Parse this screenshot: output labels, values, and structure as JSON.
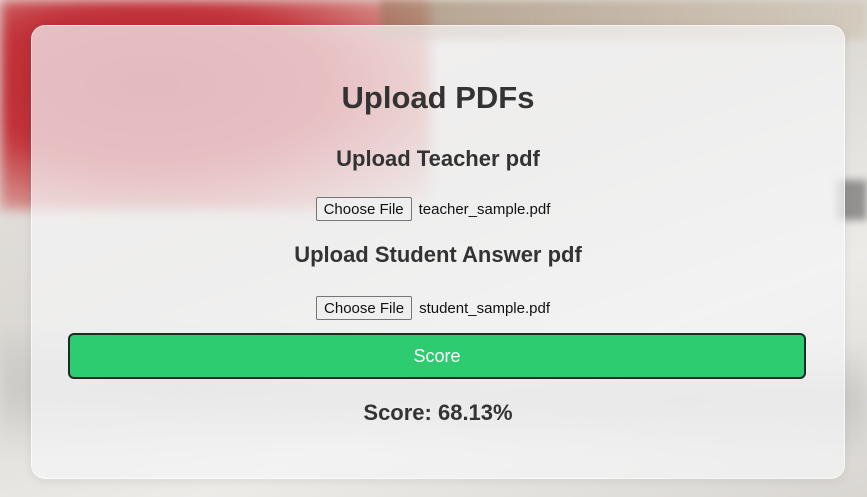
{
  "page": {
    "title": "Upload PDFs",
    "teacher_heading": "Upload Teacher pdf",
    "student_heading": "Upload Student Answer pdf"
  },
  "teacher_file": {
    "button_label": "Choose File",
    "file_name": "teacher_sample.pdf"
  },
  "student_file": {
    "button_label": "Choose File",
    "file_name": "student_sample.pdf"
  },
  "score_button": {
    "label": "Score"
  },
  "result": {
    "text": "Score: 68.13%"
  },
  "colors": {
    "score_button": "#2ecc71",
    "card_bg": "#f5f5f7",
    "heading_text": "#333333"
  }
}
